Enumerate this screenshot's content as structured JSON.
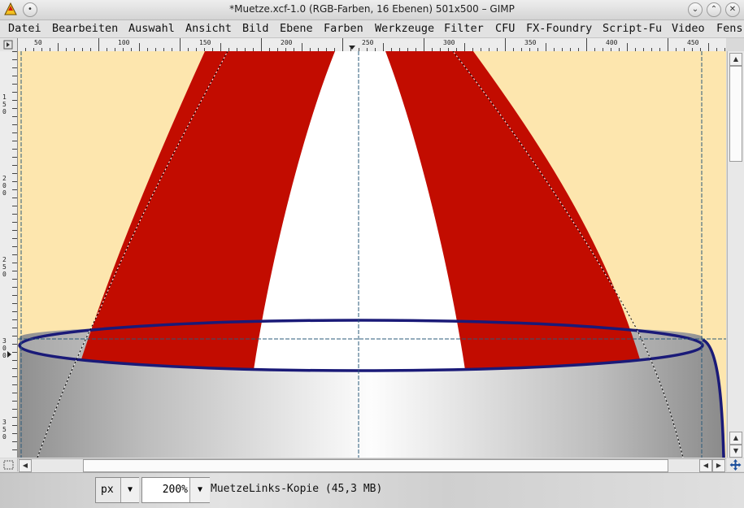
{
  "window": {
    "title": "*Muetze.xcf-1.0 (RGB-Farben, 16 Ebenen) 501x500 – GIMP",
    "minimize": "⌄",
    "maximize": "⌃",
    "close": "✕"
  },
  "menu": {
    "items": [
      "Datei",
      "Bearbeiten",
      "Auswahl",
      "Ansicht",
      "Bild",
      "Ebene",
      "Farben",
      "Werkzeuge",
      "Filter",
      "CFU",
      "FX-Foundry",
      "Script-Fu",
      "Video",
      "Fens"
    ]
  },
  "rulers": {
    "horizontal_labels": [
      "50",
      "100",
      "150",
      "200",
      "250",
      "300",
      "350",
      "400",
      "450"
    ],
    "vertical_labels": [
      "150",
      "200",
      "250",
      "300",
      "350"
    ]
  },
  "status": {
    "unit": "px",
    "zoom": "200%",
    "layer_info": "MuetzeLinks-Kopie (45,3 MB)"
  },
  "colors": {
    "background": "#fde6ae",
    "stripe_red": "#c20c00",
    "stripe_white": "#ffffff",
    "ellipse_outline": "#1a1a78",
    "guide": "#2a5a7a"
  }
}
